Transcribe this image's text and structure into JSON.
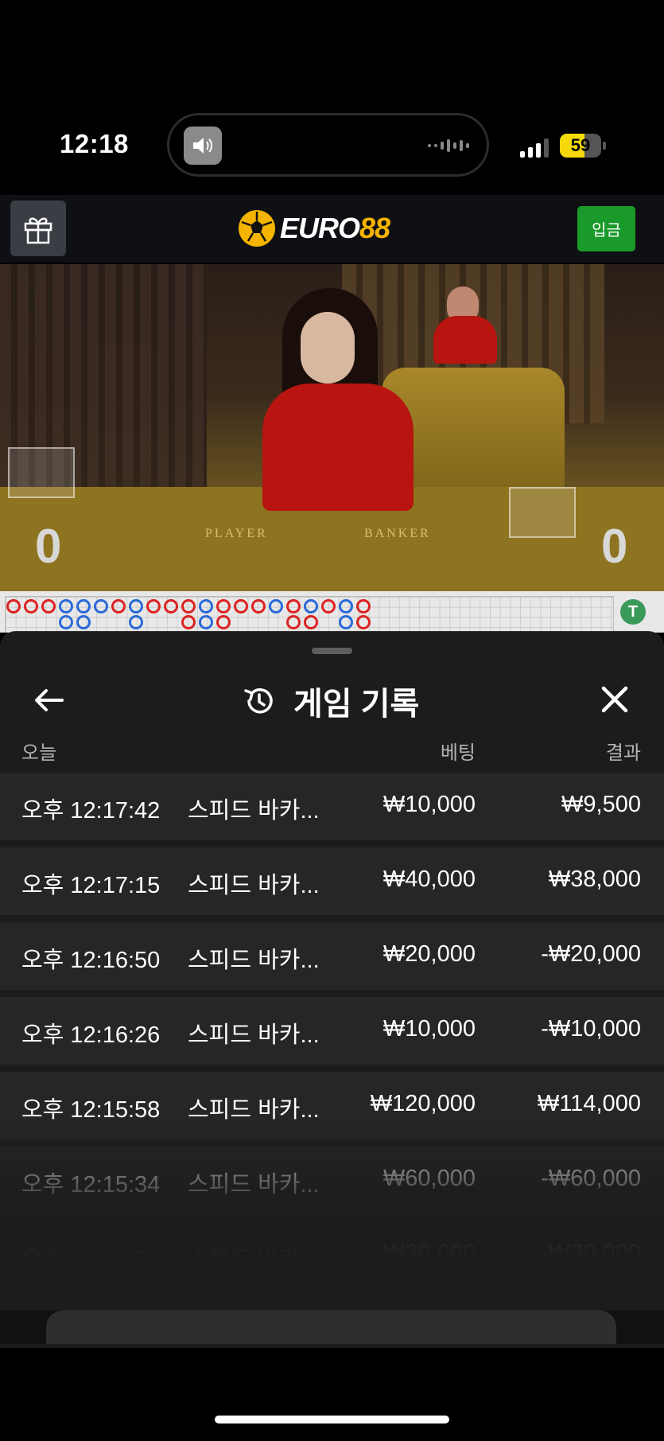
{
  "status_bar": {
    "time": "12:18",
    "battery": "59",
    "battery_level_percent": 59,
    "icons": [
      "speaker-icon",
      "cellular-signal-icon",
      "battery-icon"
    ]
  },
  "app_header": {
    "logo_text_main": "EURO",
    "logo_text_accent": "88",
    "deposit_label": "입금",
    "accent_color": "#f5b400",
    "deposit_color": "#1a9a2a"
  },
  "live_table": {
    "player_label": "PLAYER",
    "banker_label": "BANKER",
    "player_score": "0",
    "banker_score": "0",
    "tie_badge": "T"
  },
  "history_sheet": {
    "title": "게임 기록",
    "columns": {
      "date_group": "오늘",
      "bet": "베팅",
      "result": "결과"
    },
    "rows": [
      {
        "time": "오후 12:17:42",
        "game": "스피드 바카...",
        "bet": "₩10,000",
        "result": "₩9,500"
      },
      {
        "time": "오후 12:17:15",
        "game": "스피드 바카...",
        "bet": "₩40,000",
        "result": "₩38,000"
      },
      {
        "time": "오후 12:16:50",
        "game": "스피드 바카...",
        "bet": "₩20,000",
        "result": "-₩20,000"
      },
      {
        "time": "오후 12:16:26",
        "game": "스피드 바카...",
        "bet": "₩10,000",
        "result": "-₩10,000"
      },
      {
        "time": "오후 12:15:58",
        "game": "스피드 바카...",
        "bet": "₩120,000",
        "result": "₩114,000"
      },
      {
        "time": "오후 12:15:34",
        "game": "스피드 바카...",
        "bet": "₩60,000",
        "result": "-₩60,000"
      },
      {
        "time": "오후 12:15:08",
        "game": "스피드 바카...",
        "bet": "₩30,000",
        "result": "-₩30,000"
      }
    ]
  }
}
